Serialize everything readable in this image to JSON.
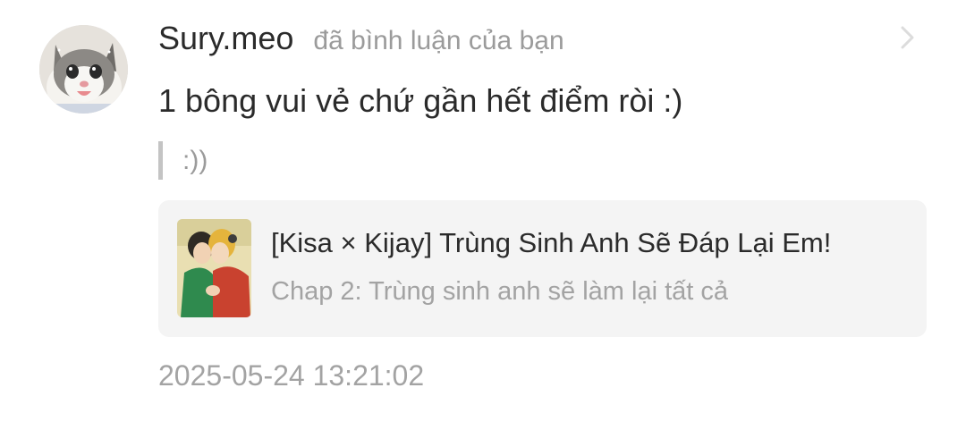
{
  "notification": {
    "avatar_icon": "cat-avatar-icon",
    "username": "Sury.meo",
    "action": "đã bình luận của bạn",
    "comment": "1 bông vui vẻ chứ gần hết điểm ròi :)",
    "quoted_reply": ":))",
    "story": {
      "cover_icon": "story-cover-image",
      "title": "[Kisa × Kijay] Trùng Sinh Anh Sẽ Đáp Lại Em!",
      "chapter": "Chap 2: Trùng sinh anh sẽ làm lại tất cả"
    },
    "timestamp": "2025-05-24 13:21:02",
    "chevron_icon": "chevron-right-icon"
  },
  "colors": {
    "text_primary": "#2b2b2b",
    "text_secondary": "#9b9b9b",
    "card_background": "#f4f4f4",
    "quote_bar": "#c4c4c4"
  }
}
